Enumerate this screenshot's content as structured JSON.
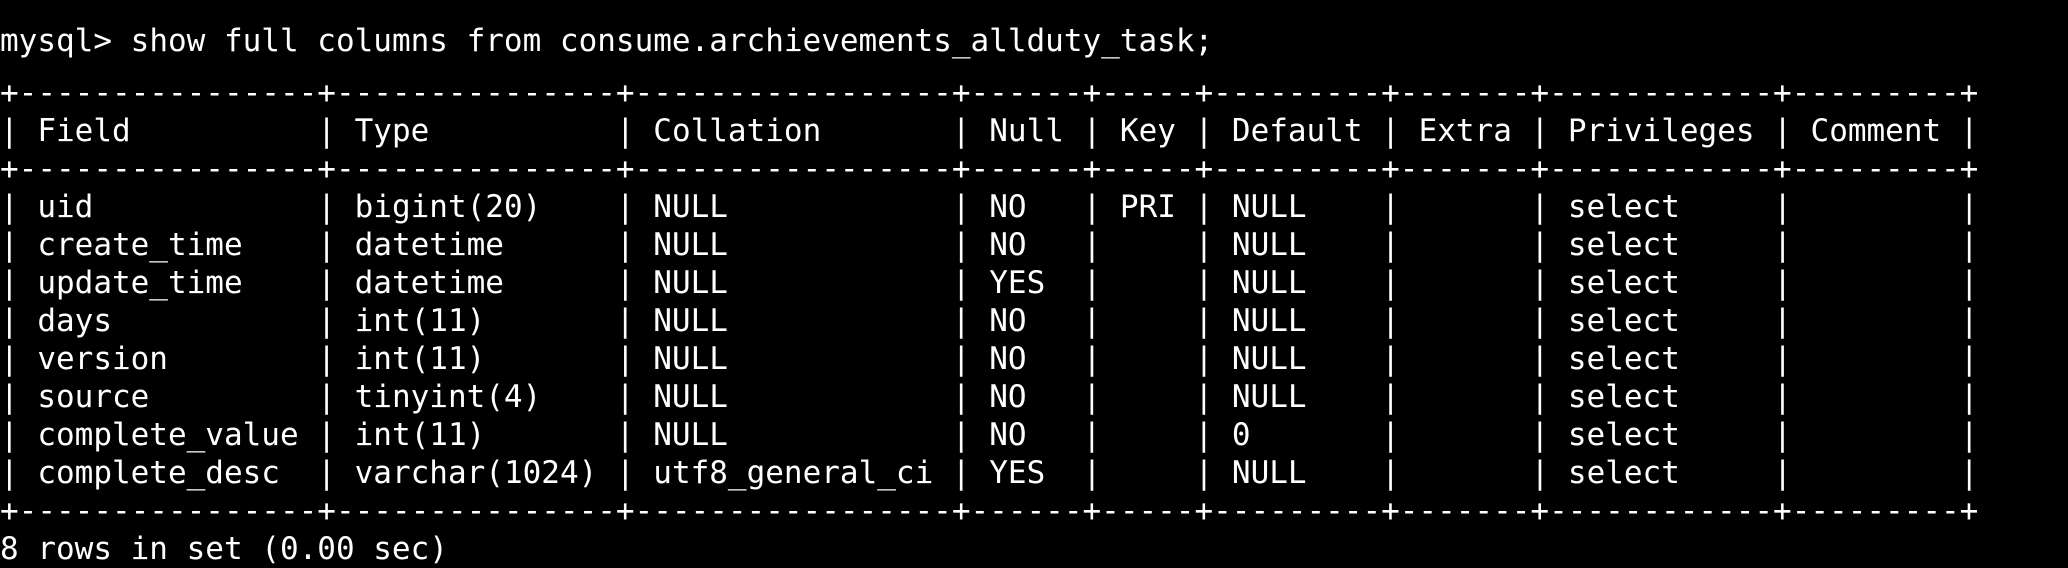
{
  "terminal": {
    "prompt": "mysql> ",
    "command": "show full columns from consume.archievements_allduty_task;",
    "columns": [
      "Field",
      "Type",
      "Collation",
      "Null",
      "Key",
      "Default",
      "Extra",
      "Privileges",
      "Comment"
    ],
    "rows": [
      [
        "uid",
        "bigint(20)",
        "NULL",
        "NO",
        "PRI",
        "NULL",
        "",
        "select",
        ""
      ],
      [
        "create_time",
        "datetime",
        "NULL",
        "NO",
        "",
        "NULL",
        "",
        "select",
        ""
      ],
      [
        "update_time",
        "datetime",
        "NULL",
        "YES",
        "",
        "NULL",
        "",
        "select",
        ""
      ],
      [
        "days",
        "int(11)",
        "NULL",
        "NO",
        "",
        "NULL",
        "",
        "select",
        ""
      ],
      [
        "version",
        "int(11)",
        "NULL",
        "NO",
        "",
        "NULL",
        "",
        "select",
        ""
      ],
      [
        "source",
        "tinyint(4)",
        "NULL",
        "NO",
        "",
        "NULL",
        "",
        "select",
        ""
      ],
      [
        "complete_value",
        "int(11)",
        "NULL",
        "NO",
        "",
        "0",
        "",
        "select",
        ""
      ],
      [
        "complete_desc",
        "varchar(1024)",
        "utf8_general_ci",
        "YES",
        "",
        "NULL",
        "",
        "select",
        ""
      ]
    ],
    "result_summary": "8 rows in set (0.00 sec)"
  },
  "colors": {
    "background": "#000000",
    "text": "#ffffff"
  }
}
